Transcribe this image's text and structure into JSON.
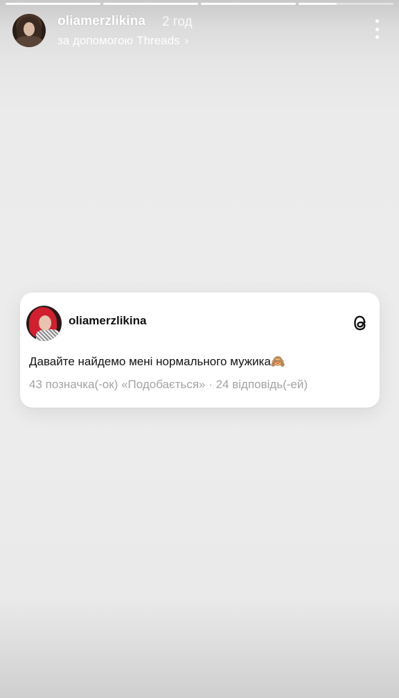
{
  "story": {
    "progress": {
      "segments": [
        1,
        1,
        1,
        0.4
      ]
    },
    "header": {
      "username": "oliamerzlikina",
      "time": "2 год",
      "via_prefix": "за допомогою",
      "via_app": "Threads",
      "chevron_icon": "chevron-right-icon",
      "more_icon": "more-vertical-icon"
    }
  },
  "card": {
    "username": "oliamerzlikina",
    "logo_icon": "threads-logo-icon",
    "text": "Давайте найдемо мені нормального мужика🙈",
    "stats": "43 позначка(-ок) «Подобається» · 24 відповідь(-ей)"
  },
  "colors": {
    "card_bg": "#ffffff",
    "stats_text": "#a3a3a3"
  }
}
